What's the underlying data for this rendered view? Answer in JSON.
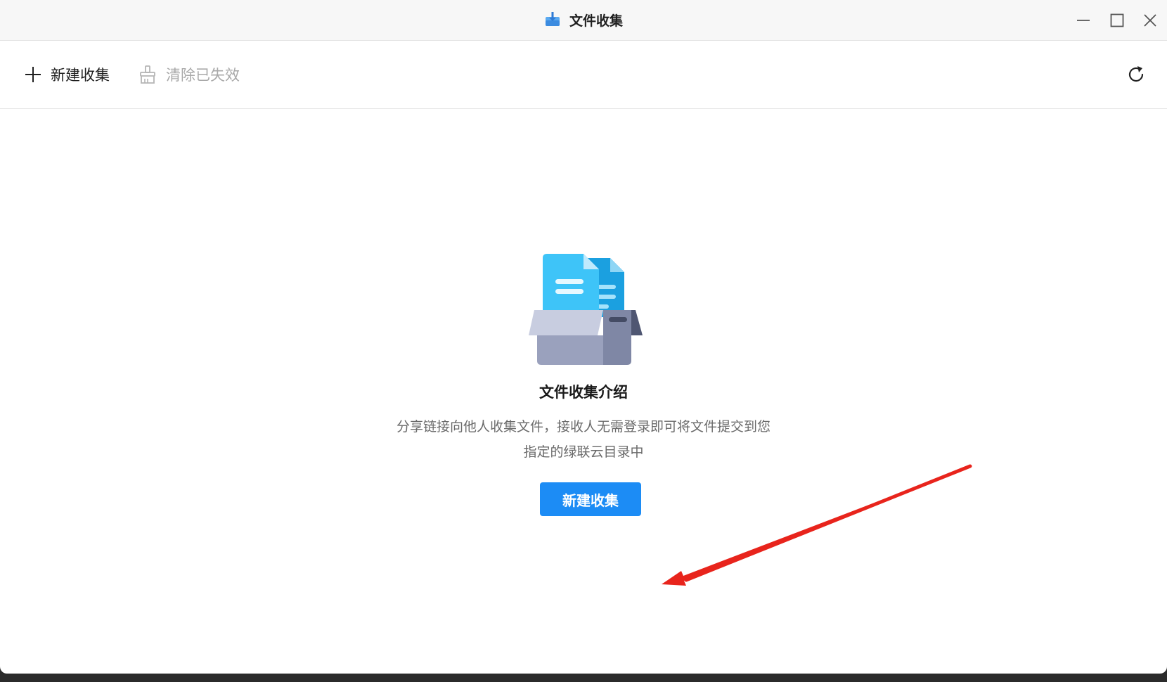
{
  "window": {
    "title": "文件收集",
    "app_icon": "inbox-download-icon",
    "controls": [
      "minimize-icon",
      "maximize-icon",
      "close-icon"
    ]
  },
  "toolbar": {
    "new_label": "新建收集",
    "new_icon": "plus-icon",
    "clear_label": "清除已失效",
    "clear_icon": "broom-icon",
    "clear_disabled": true,
    "refresh_icon": "refresh-icon"
  },
  "empty_state": {
    "illustration": "files-in-box-icon",
    "title": "文件收集介绍",
    "description_line1": "分享链接向他人收集文件，接收人无需登录即可将文件提交到您",
    "description_line2": "指定的绿联云目录中",
    "button_label": "新建收集"
  },
  "colors": {
    "primary": "#1c8cf5",
    "annotation_arrow": "#e8241c",
    "disabled_text": "#a9a9a9"
  }
}
